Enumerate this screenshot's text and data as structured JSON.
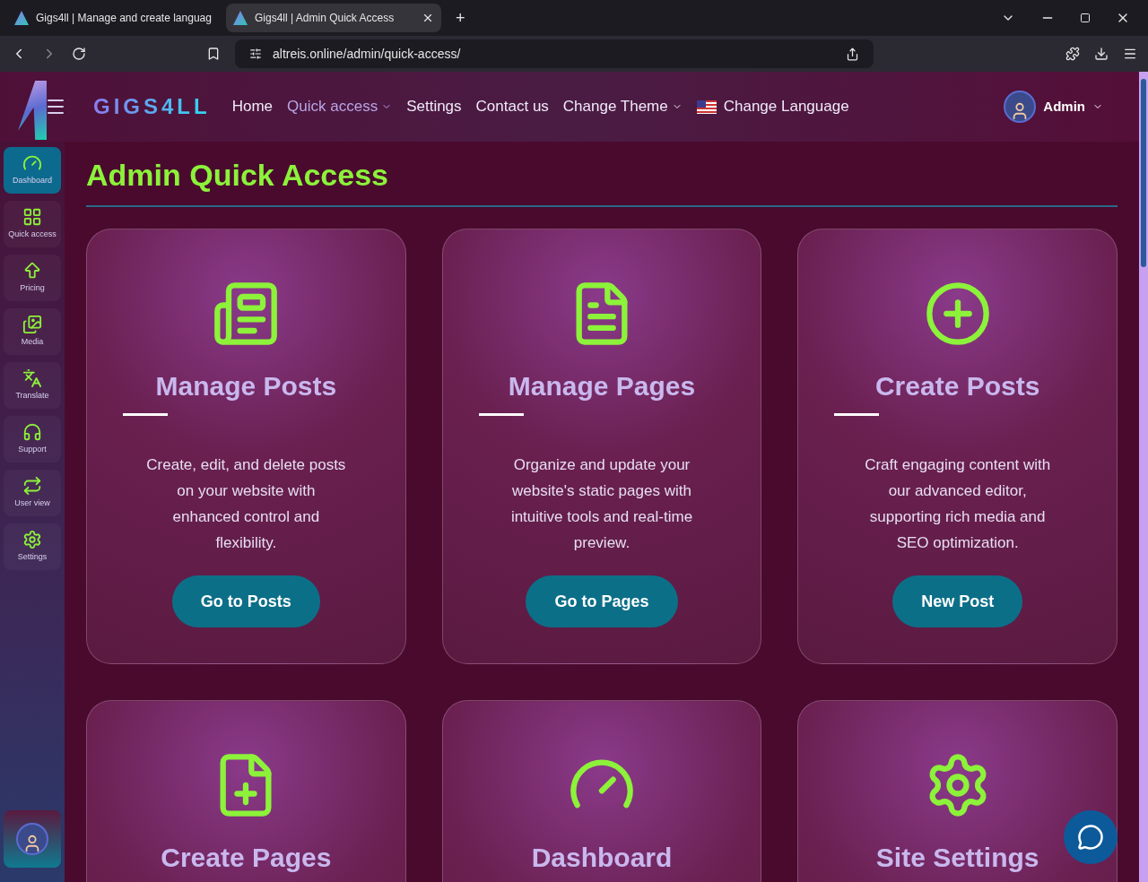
{
  "browser": {
    "tabs": [
      {
        "label": "Gigs4ll | Manage and create languag",
        "selected": false
      },
      {
        "label": "Gigs4ll | Admin Quick Access",
        "selected": true
      }
    ],
    "new_tab": "+",
    "url": "altreis.online/admin/quick-access/"
  },
  "header": {
    "brand": "GIGS4LL",
    "nav": [
      {
        "label": "Home",
        "kind": "link",
        "selected": false
      },
      {
        "label": "Quick access",
        "kind": "dropdown",
        "selected": true
      },
      {
        "label": "Settings",
        "kind": "link",
        "selected": false
      },
      {
        "label": "Contact us",
        "kind": "link",
        "selected": false
      },
      {
        "label": "Change Theme",
        "kind": "dropdown",
        "selected": false
      },
      {
        "label": "Change Language",
        "kind": "flag",
        "selected": false
      }
    ],
    "user": "Admin"
  },
  "sidebar": [
    {
      "label": "Dashboard",
      "kind": "gauge",
      "selected": true
    },
    {
      "label": "Quick access",
      "kind": "grid",
      "selected": false
    },
    {
      "label": "Pricing",
      "kind": "up",
      "selected": false
    },
    {
      "label": "Media",
      "kind": "images",
      "selected": false
    },
    {
      "label": "Translate",
      "kind": "translate",
      "selected": false
    },
    {
      "label": "Support",
      "kind": "headset",
      "selected": false
    },
    {
      "label": "User view",
      "kind": "repeat",
      "selected": false
    },
    {
      "label": "Settings",
      "kind": "gear",
      "selected": false
    }
  ],
  "page_title": "Admin Quick Access",
  "cards": [
    {
      "kind": "newspaper",
      "title": "Manage Posts",
      "description": "Create, edit, and delete posts on your website with enhanced control and flexibility.",
      "button": "Go to Posts"
    },
    {
      "kind": "file",
      "title": "Manage Pages",
      "description": "Organize and update your website's static pages with intuitive tools and real-time preview.",
      "button": "Go to Pages"
    },
    {
      "kind": "plus",
      "title": "Create Posts",
      "description": "Craft engaging content with our advanced editor, supporting rich media and SEO optimization.",
      "button": "New Post"
    },
    {
      "kind": "fileplus",
      "title": "Create Pages"
    },
    {
      "kind": "gauge",
      "title": "Dashboard"
    },
    {
      "kind": "gear",
      "title": "Site Settings"
    }
  ]
}
